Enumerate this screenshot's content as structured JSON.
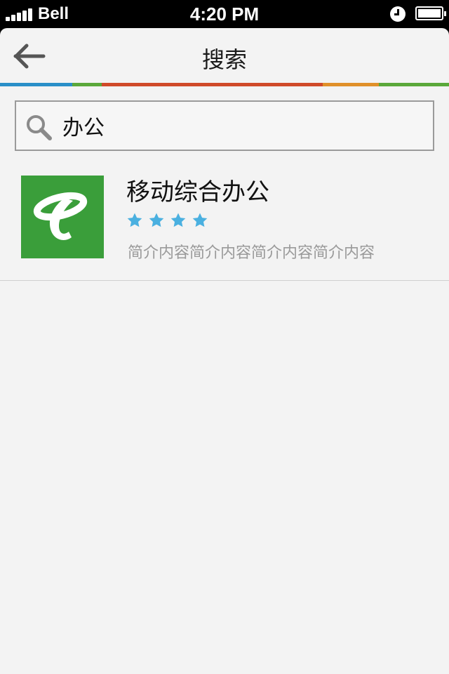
{
  "status_bar": {
    "carrier": "Bell",
    "time": "4:20 PM",
    "signal_bars": 5,
    "icons": [
      "signal-icon",
      "alarm-icon",
      "battery-icon"
    ]
  },
  "nav": {
    "title": "搜索",
    "back_icon": "arrow-left-icon"
  },
  "search": {
    "value": "办公",
    "placeholder": "",
    "icon": "search-icon"
  },
  "results": [
    {
      "name": "移动综合办公",
      "rating": 4,
      "description": "简介内容简介内容简介内容简介内容",
      "icon": "telecom-logo-icon"
    }
  ],
  "colors": {
    "background": "#f3f3f3",
    "app_icon_bg": "#3a9e3a",
    "star": "#4ab0e0",
    "accent_stripes": [
      "#2a8fc8",
      "#5aa83a",
      "#d04a2a",
      "#e0902a",
      "#5aa83a"
    ]
  }
}
